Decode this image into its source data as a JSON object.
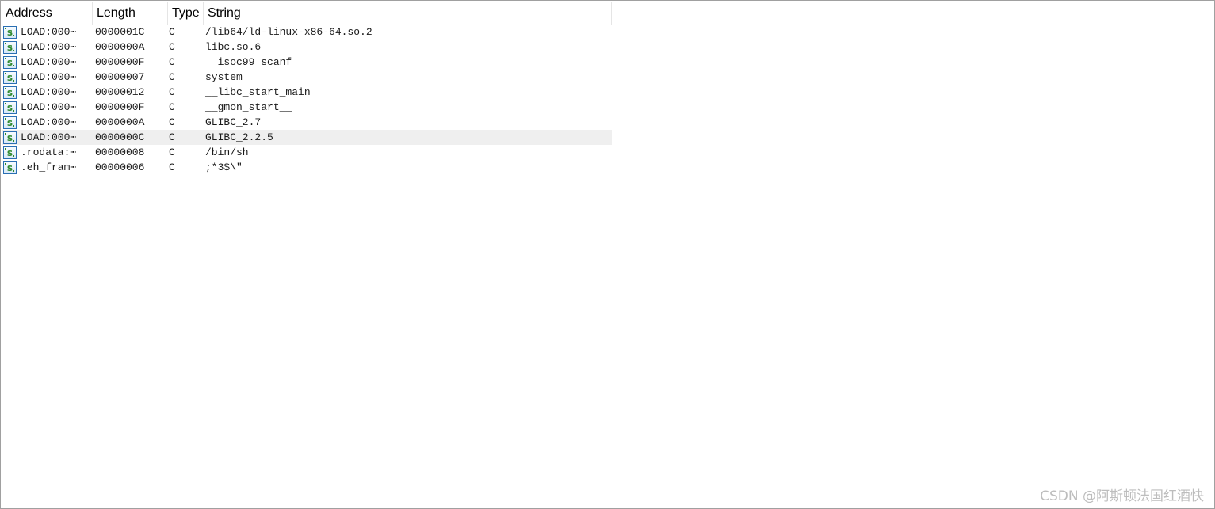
{
  "columns": {
    "address": "Address",
    "length": "Length",
    "type": "Type",
    "string": "String"
  },
  "icon": {
    "name": "string-s-icon",
    "letter": "s",
    "border_color": "#2a6fb3",
    "letter_color": "#2f8a2f"
  },
  "selected_row_index": 7,
  "rows": [
    {
      "address": "LOAD:000⋯",
      "length": "0000001C",
      "type": "C",
      "string": "/lib64/ld-linux-x86-64.so.2"
    },
    {
      "address": "LOAD:000⋯",
      "length": "0000000A",
      "type": "C",
      "string": "libc.so.6"
    },
    {
      "address": "LOAD:000⋯",
      "length": "0000000F",
      "type": "C",
      "string": "__isoc99_scanf"
    },
    {
      "address": "LOAD:000⋯",
      "length": "00000007",
      "type": "C",
      "string": "system"
    },
    {
      "address": "LOAD:000⋯",
      "length": "00000012",
      "type": "C",
      "string": "__libc_start_main"
    },
    {
      "address": "LOAD:000⋯",
      "length": "0000000F",
      "type": "C",
      "string": "__gmon_start__"
    },
    {
      "address": "LOAD:000⋯",
      "length": "0000000A",
      "type": "C",
      "string": "GLIBC_2.7"
    },
    {
      "address": "LOAD:000⋯",
      "length": "0000000C",
      "type": "C",
      "string": "GLIBC_2.2.5"
    },
    {
      "address": ".rodata:⋯",
      "length": "00000008",
      "type": "C",
      "string": "/bin/sh"
    },
    {
      "address": ".eh_fram⋯",
      "length": "00000006",
      "type": "C",
      "string": ";*3$\\\""
    }
  ],
  "watermark": "CSDN @阿斯顿法国红酒快"
}
